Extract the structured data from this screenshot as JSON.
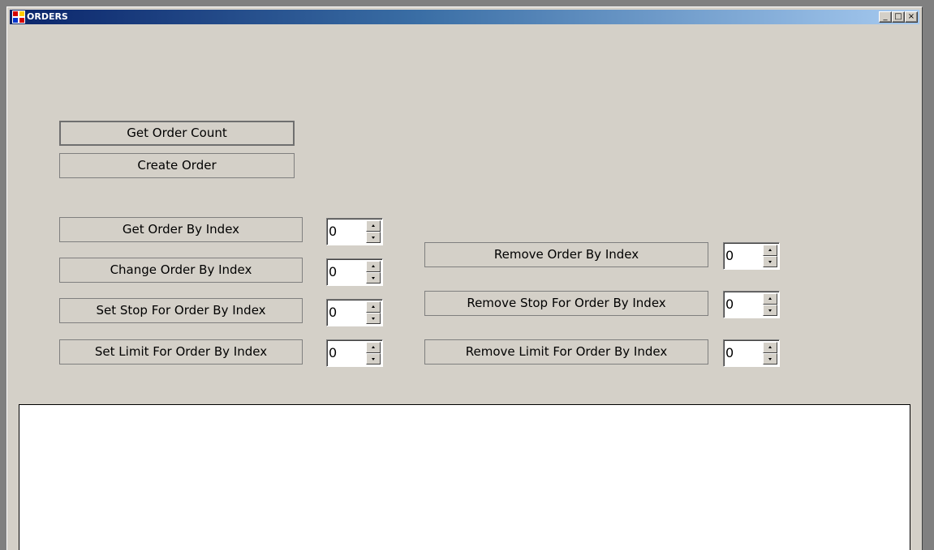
{
  "window": {
    "title": "ORDERS",
    "minimize_label": "_",
    "maximize_label": "□",
    "close_label": "×"
  },
  "buttons": {
    "get_order_count": "Get Order Count",
    "create_order": "Create Order",
    "get_order_by_index": "Get Order By Index",
    "change_order_by_index": "Change Order By Index",
    "set_stop_for_order_by_index": "Set Stop For Order By Index",
    "set_limit_for_order_by_index": "Set Limit For Order By Index",
    "remove_order_by_index": "Remove Order By Index",
    "remove_stop_for_order_by_index": "Remove Stop For Order By Index",
    "remove_limit_for_order_by_index": "Remove Limit For Order By Index"
  },
  "spinners": {
    "get_order_index": "0",
    "change_order_index": "0",
    "set_stop_index": "0",
    "set_limit_index": "0",
    "remove_order_index": "0",
    "remove_stop_index": "0",
    "remove_limit_index": "0"
  },
  "output": {
    "text": ""
  }
}
